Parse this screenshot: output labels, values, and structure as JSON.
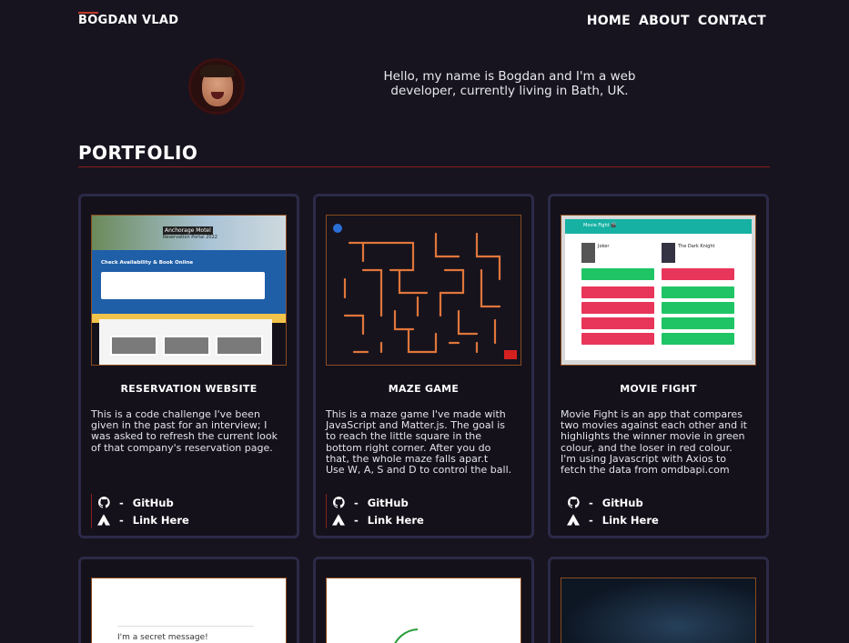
{
  "header": {
    "brand": "BOGDAN VLAD",
    "nav": [
      "HOME",
      "ABOUT",
      "CONTACT"
    ]
  },
  "intro": {
    "text": "Hello, my name is Bogdan and I'm a web developer, currently living in Bath, UK."
  },
  "portfolio": {
    "title": "PORTFOLIO",
    "cards": [
      {
        "title": "RESERVATION WEBSITE",
        "description": "This is a code challenge I've been given in the past for an interview; I was asked to refresh the current look of that company's reservation page.",
        "github_label": "GitHub",
        "link_label": "Link Here",
        "thumb": {
          "hotel_name": "Anchorage Motel",
          "hotel_sub": "Reservation Portal 2022",
          "form_title": "Check Availability & Book Online"
        }
      },
      {
        "title": "MAZE GAME",
        "description": "This is a maze game I've made with JavaScript and Matter.js. The goal is to reach the little square in the bottom right corner. After you do that, the whole maze falls apar.t\nUse W, A, S and D to control the ball.",
        "github_label": "GitHub",
        "link_label": "Link Here"
      },
      {
        "title": "MOVIE FIGHT",
        "description": "Movie Fight is an app that compares two movies against each other and it highlights the winner movie in green colour, and the loser in red colour.\nI'm using Javascript with Axios to fetch the data from omdbapi.com",
        "github_label": "GitHub",
        "link_label": "Link Here",
        "thumb": {
          "bar_title": "Movie Fight 🎬",
          "movie_left": "Joker",
          "movie_right": "The Dark Knight"
        }
      }
    ],
    "second_row": {
      "card1_text": "I'm a secret message!"
    }
  },
  "colors": {
    "background": "#17141f",
    "card_border": "#2c2a48",
    "accent_red": "#8b1f1f",
    "maze_lines": "#e0763a",
    "maze_ball": "#2a6fd6",
    "maze_goal": "#d62020",
    "win_green": "#1fc565",
    "lose_red": "#e8355a"
  },
  "icons": {
    "github": "github-icon",
    "link": "tent-link-icon"
  }
}
